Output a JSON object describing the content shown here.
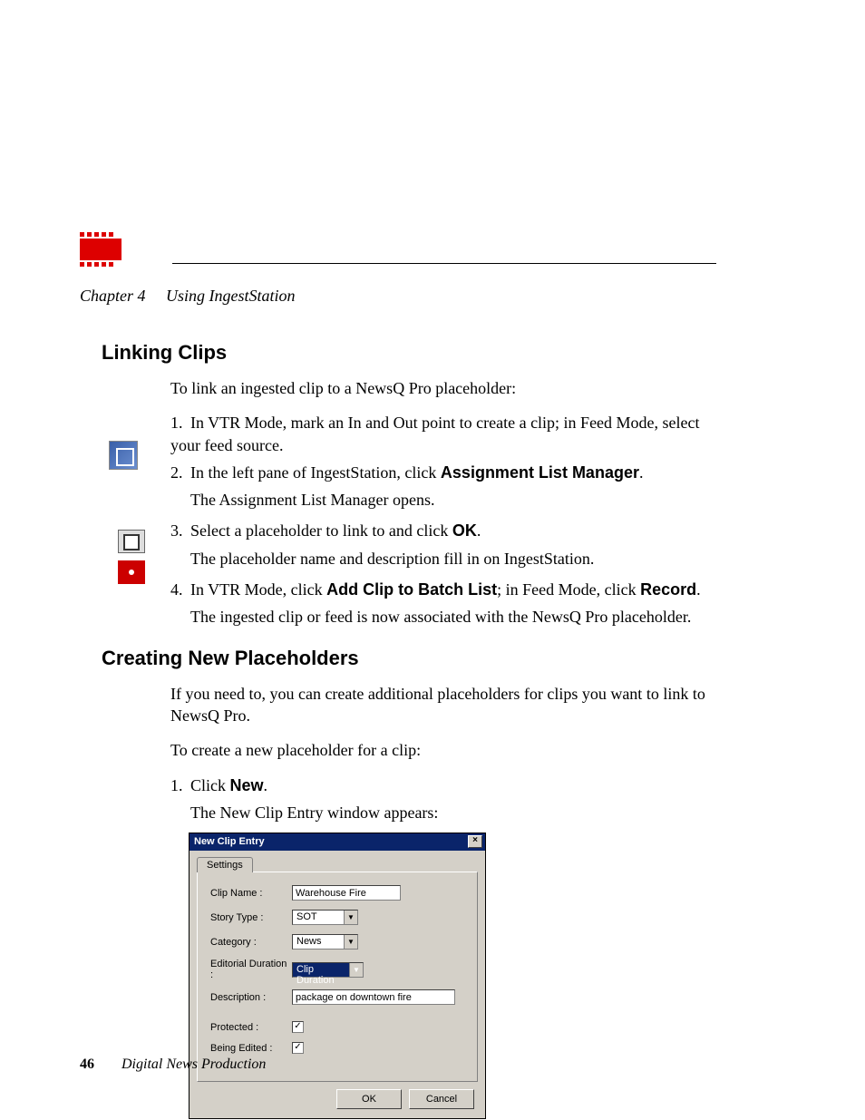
{
  "header": {
    "chapter_label": "Chapter 4",
    "chapter_title": "Using IngestStation"
  },
  "section1": {
    "heading": "Linking Clips",
    "intro": "To link an ingested clip to a NewsQ Pro placeholder:",
    "steps": {
      "s1": {
        "num": "1.",
        "text": "In VTR Mode, mark an In and Out point to create a clip; in Feed Mode, select your feed source."
      },
      "s2": {
        "num": "2.",
        "pre": "In the left pane of IngestStation, click ",
        "bold": "Assignment List Manager",
        "post": ".",
        "after": "The Assignment List Manager opens."
      },
      "s3": {
        "num": "3.",
        "pre": "Select a placeholder to link to and click ",
        "bold": "OK",
        "post": ".",
        "after": "The placeholder name and description fill in on IngestStation."
      },
      "s4": {
        "num": "4.",
        "pre": "In VTR Mode, click ",
        "bold1": "Add Clip to Batch List",
        "mid": "; in Feed Mode, click ",
        "bold2": "Record",
        "post": ".",
        "after": "The ingested clip or feed is now associated with the NewsQ Pro placeholder."
      }
    }
  },
  "section2": {
    "heading": "Creating New Placeholders",
    "intro1": "If you need to, you can create additional placeholders for clips you want to link to NewsQ Pro.",
    "intro2": "To create a new placeholder for a clip:",
    "step1": {
      "num": "1.",
      "pre": "Click ",
      "bold": "New",
      "post": ".",
      "after": "The New Clip Entry window appears:"
    }
  },
  "dialog": {
    "title": "New Clip Entry",
    "close": "×",
    "tab": "Settings",
    "labels": {
      "clip_name": "Clip Name :",
      "story_type": "Story Type :",
      "category": "Category :",
      "editorial_duration": "Editorial Duration :",
      "description": "Description :",
      "protected": "Protected :",
      "being_edited": "Being Edited :"
    },
    "values": {
      "clip_name": "Warehouse Fire",
      "story_type": "SOT",
      "category": "News",
      "editorial_duration": "Clip Duration",
      "description": "package on downtown fire"
    },
    "dropdown_glyph": "▼",
    "check_glyph": "✓",
    "buttons": {
      "ok": "OK",
      "cancel": "Cancel"
    }
  },
  "footer": {
    "page": "46",
    "title": "Digital News Production"
  }
}
